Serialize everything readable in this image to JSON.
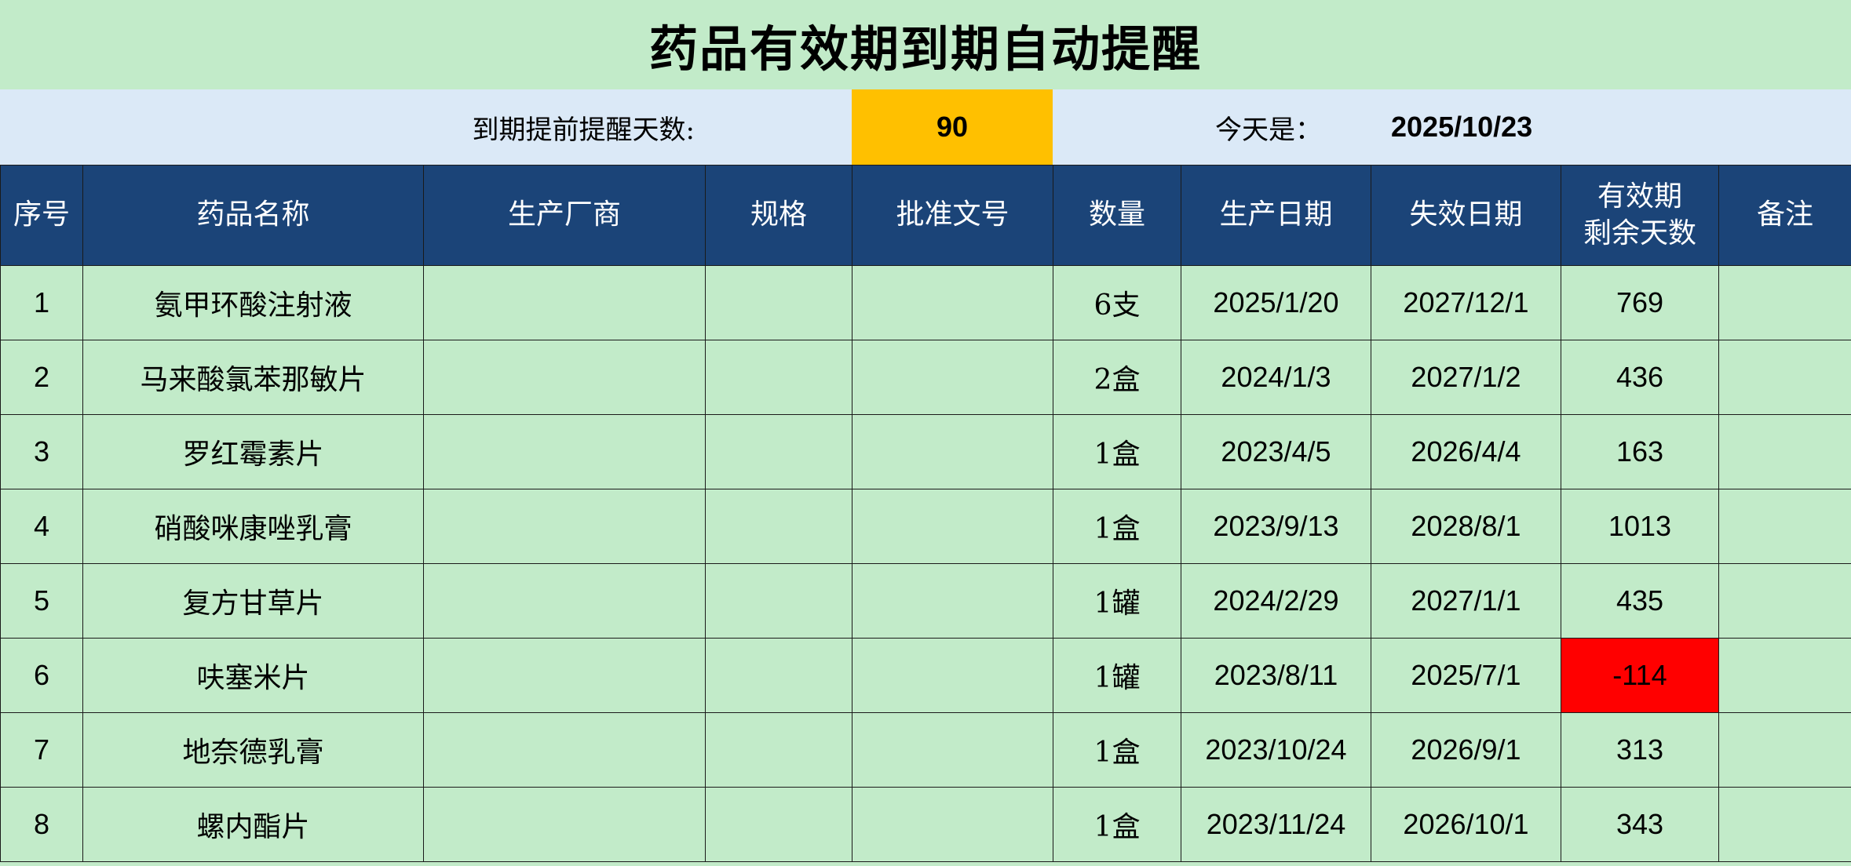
{
  "title": "药品有效期到期自动提醒",
  "reminder": {
    "label": "到期提前提醒天数:",
    "days": "90",
    "today_label": "今天是：",
    "today_value": "2025/10/23"
  },
  "headers": {
    "index": "序号",
    "name": "药品名称",
    "manufacturer": "生产厂商",
    "spec": "规格",
    "approval": "批准文号",
    "quantity": "数量",
    "prod_date": "生产日期",
    "exp_date": "失效日期",
    "remaining_line1": "有效期",
    "remaining_line2": "剩余天数",
    "note": "备注"
  },
  "rows": [
    {
      "index": "1",
      "name": "氨甲环酸注射液",
      "manufacturer": "",
      "spec": "",
      "approval": "",
      "quantity": "6支",
      "prod_date": "2025/1/20",
      "exp_date": "2027/12/1",
      "remaining": "769",
      "note": ""
    },
    {
      "index": "2",
      "name": "马来酸氯苯那敏片",
      "manufacturer": "",
      "spec": "",
      "approval": "",
      "quantity": "2盒",
      "prod_date": "2024/1/3",
      "exp_date": "2027/1/2",
      "remaining": "436",
      "note": ""
    },
    {
      "index": "3",
      "name": "罗红霉素片",
      "manufacturer": "",
      "spec": "",
      "approval": "",
      "quantity": "1盒",
      "prod_date": "2023/4/5",
      "exp_date": "2026/4/4",
      "remaining": "163",
      "note": ""
    },
    {
      "index": "4",
      "name": "硝酸咪康唑乳膏",
      "manufacturer": "",
      "spec": "",
      "approval": "",
      "quantity": "1盒",
      "prod_date": "2023/9/13",
      "exp_date": "2028/8/1",
      "remaining": "1013",
      "note": ""
    },
    {
      "index": "5",
      "name": "复方甘草片",
      "manufacturer": "",
      "spec": "",
      "approval": "",
      "quantity": "1罐",
      "prod_date": "2024/2/29",
      "exp_date": "2027/1/1",
      "remaining": "435",
      "note": ""
    },
    {
      "index": "6",
      "name": "呋塞米片",
      "manufacturer": "",
      "spec": "",
      "approval": "",
      "quantity": "1罐",
      "prod_date": "2023/8/11",
      "exp_date": "2025/7/1",
      "remaining": "-114",
      "note": ""
    },
    {
      "index": "7",
      "name": "地奈德乳膏",
      "manufacturer": "",
      "spec": "",
      "approval": "",
      "quantity": "1盒",
      "prod_date": "2023/10/24",
      "exp_date": "2026/9/1",
      "remaining": "313",
      "note": ""
    },
    {
      "index": "8",
      "name": "螺内酯片",
      "manufacturer": "",
      "spec": "",
      "approval": "",
      "quantity": "1盒",
      "prod_date": "2023/11/24",
      "exp_date": "2026/10/1",
      "remaining": "343",
      "note": ""
    }
  ],
  "colors": {
    "background": "#c2ebc9",
    "info_band": "#dbe9f7",
    "days_highlight": "#ffc000",
    "header": "#1b4478",
    "expired_alert": "#ff0000"
  }
}
